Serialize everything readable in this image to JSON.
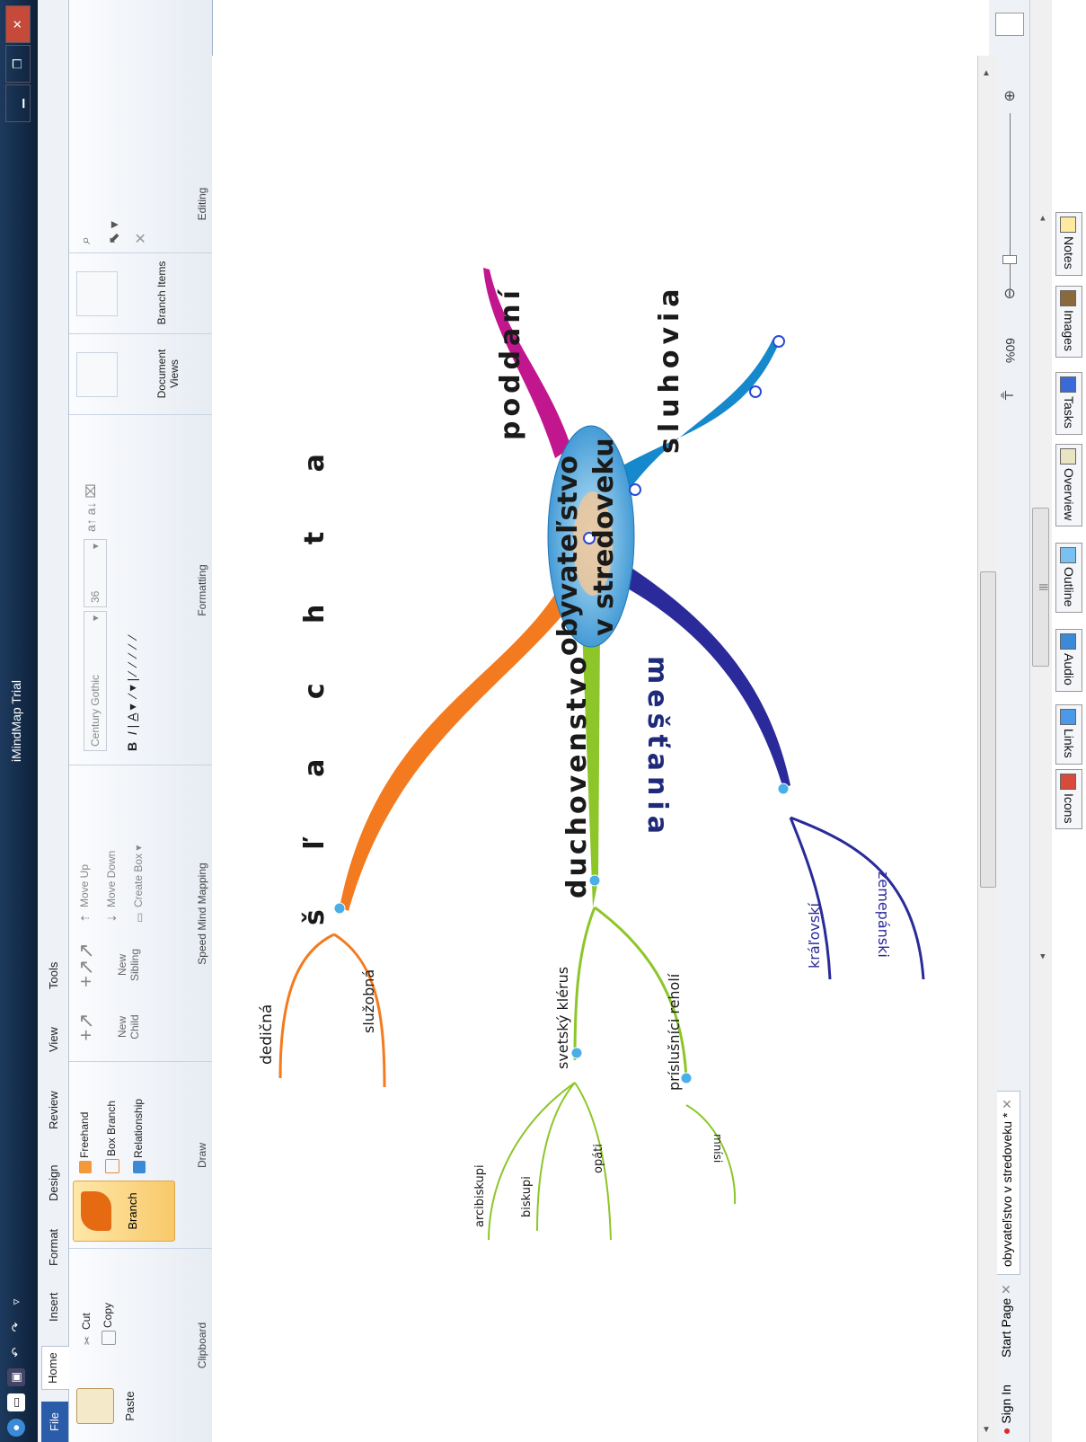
{
  "window": {
    "title": "iMindMap Trial"
  },
  "ribbon": {
    "tabs": [
      "File",
      "Home",
      "Insert",
      "Format",
      "Design",
      "Review",
      "View",
      "Tools"
    ],
    "clipboard": {
      "paste": "Paste",
      "cut": "Cut",
      "copy": "Copy",
      "label": "Clipboard"
    },
    "draw": {
      "branch": "Branch",
      "freehand": "Freehand",
      "box_branch": "Box Branch",
      "relationship": "Relationship",
      "label": "Draw"
    },
    "speed": {
      "new_child": "New Child",
      "new_sibling": "New Sibling",
      "move_up": "Move Up",
      "move_down": "Move Down",
      "create_box": "Create Box",
      "label": "Speed Mind Mapping"
    },
    "formatting": {
      "font": "Century Gothic",
      "size": "36",
      "label": "Formatting"
    },
    "views": {
      "document_views": "Document Views",
      "branch_items": "Branch Items"
    },
    "editing": {
      "label": "Editing"
    }
  },
  "toolbar_tabs": [
    "Notes",
    "Images",
    "Tasks",
    "Overview",
    "Outline",
    "Audio",
    "Links",
    "Icons"
  ],
  "status": {
    "zoom": "60%"
  },
  "doc_tabs": {
    "start_page": "Start Page",
    "document": "obyvateľstvo v stredoveku *",
    "sign_in": "Sign In"
  },
  "mindmap": {
    "center": [
      "obyvateľstvo",
      "v stredoveku"
    ],
    "branches": {
      "slachta": "š ľ a c h t a",
      "poddani": "poddaní",
      "sluhovia": "sluhovia",
      "duchovenstvo": "duchovenstvo",
      "mestania": "mešťania"
    },
    "sub": {
      "dedicna": "dedičná",
      "sluzobna": "služobná",
      "svetsky": "svetský klérus",
      "prislusnici": "príslušníci reholí",
      "arcibiskupi": "arcibiskupi",
      "biskupi": "biskupi",
      "opati": "opáti",
      "mnisi": "mnísi",
      "kralovski": "kráľovskí",
      "zemepanski": "zemepánski"
    }
  },
  "colors": {
    "slachta": "#f47a1f",
    "poddani": "#c2168f",
    "sluhovia": "#1688cc",
    "duchovenstvo": "#8dc629",
    "mestania": "#2a2a9a"
  }
}
